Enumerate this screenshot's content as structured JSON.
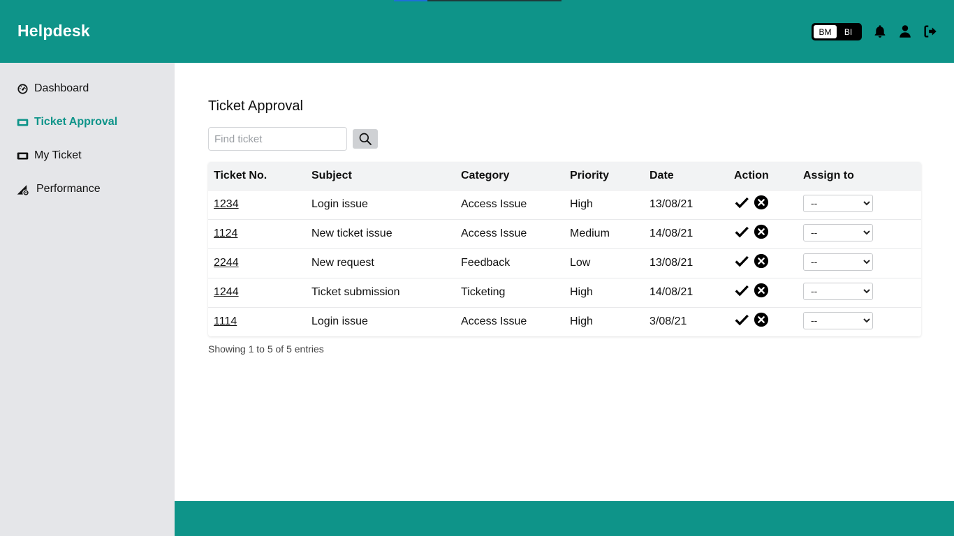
{
  "colors": {
    "brand": "#0e9489",
    "background": "#ffffff",
    "sidebar": "#e5e6e9"
  },
  "header": {
    "title": "Helpdesk",
    "languages": [
      {
        "label": "BM",
        "active": true
      },
      {
        "label": "BI",
        "active": false
      }
    ],
    "icons": [
      "bell-icon",
      "user-icon",
      "logout-icon"
    ]
  },
  "sidebar": {
    "items": [
      {
        "label": "Dashboard",
        "icon": "dashboard-gauge-icon",
        "active": false
      },
      {
        "label": "Ticket Approval",
        "icon": "ticket-icon",
        "active": true
      },
      {
        "label": "My Ticket",
        "icon": "ticket-icon",
        "active": false
      },
      {
        "label": "Performance",
        "icon": "performance-chart-icon",
        "active": false
      }
    ]
  },
  "main": {
    "title": "Ticket Approval",
    "search": {
      "placeholder": "Find ticket",
      "value": ""
    },
    "table": {
      "columns": [
        "Ticket No.",
        "Subject",
        "Category",
        "Priority",
        "Date",
        "Action",
        "Assign to"
      ],
      "rows": [
        {
          "ticket_no": "1234",
          "subject": "Login issue",
          "category": "Access Issue",
          "priority": "High",
          "date": "13/08/21",
          "assign_to": "--"
        },
        {
          "ticket_no": "1124",
          "subject": "New ticket issue",
          "category": "Access Issue",
          "priority": "Medium",
          "date": "14/08/21",
          "assign_to": "--"
        },
        {
          "ticket_no": "2244",
          "subject": "New request",
          "category": "Feedback",
          "priority": "Low",
          "date": "13/08/21",
          "assign_to": "--"
        },
        {
          "ticket_no": "1244",
          "subject": "Ticket submission",
          "category": "Ticketing",
          "priority": "High",
          "date": "14/08/21",
          "assign_to": "--"
        },
        {
          "ticket_no": "1114",
          "subject": "Login issue",
          "category": "Access Issue",
          "priority": "High",
          "date": "3/08/21",
          "assign_to": "--"
        }
      ]
    },
    "entries_info": "Showing 1 to 5 of 5 entries"
  }
}
